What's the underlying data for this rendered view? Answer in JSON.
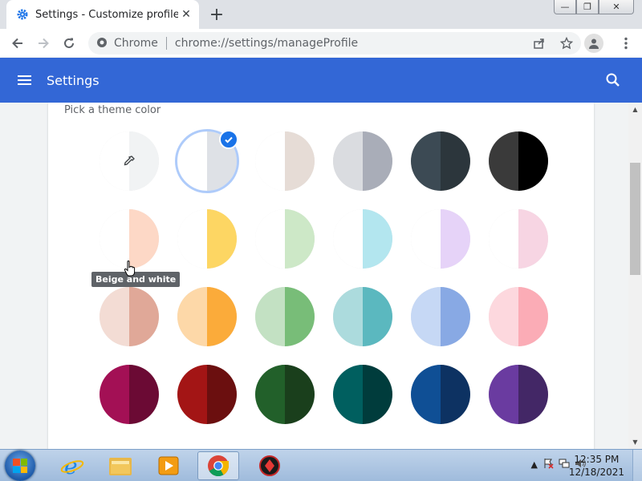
{
  "tab": {
    "title": "Settings - Customize profile",
    "close": "✕"
  },
  "newtab": "+",
  "window": {
    "min": "—",
    "max": "❐",
    "close": "✕"
  },
  "omnibox": {
    "chip": "Chrome",
    "url": "chrome://settings/manageProfile"
  },
  "header": {
    "title": "Settings"
  },
  "section": {
    "title": "Pick a theme color"
  },
  "tooltip": "Beige and white",
  "swatches": [
    {
      "name": "custom-color",
      "l": "#ffffff",
      "r": "#f1f3f4"
    },
    {
      "name": "default",
      "l": "#ffffff",
      "r": "#dee1e6",
      "selected": true
    },
    {
      "name": "light-beige",
      "l": "#ffffff",
      "r": "#e6dcd6"
    },
    {
      "name": "light-grey",
      "l": "#dadce0",
      "r": "#a9adb8"
    },
    {
      "name": "dark-slate",
      "l": "#3c4a54",
      "r": "#2c363c"
    },
    {
      "name": "black",
      "l": "#3a3a3a",
      "r": "#000000"
    },
    {
      "name": "beige-and-white",
      "l": "#ffffff",
      "r": "#fdd8c6"
    },
    {
      "name": "yellow-and-white",
      "l": "#ffffff",
      "r": "#fdd663"
    },
    {
      "name": "green-and-white",
      "l": "#ffffff",
      "r": "#cde8c7"
    },
    {
      "name": "light-teal-and-white",
      "l": "#ffffff",
      "r": "#b3e6ef"
    },
    {
      "name": "light-purple-and-white",
      "l": "#ffffff",
      "r": "#e6d3f8"
    },
    {
      "name": "pink-and-white",
      "l": "#ffffff",
      "r": "#f7d5e3"
    },
    {
      "name": "beige",
      "l": "#f3dcd4",
      "r": "#e0a898"
    },
    {
      "name": "orange",
      "l": "#fdd8a8",
      "r": "#fbab3a"
    },
    {
      "name": "light-green",
      "l": "#c3e1c3",
      "r": "#78bd78"
    },
    {
      "name": "light-teal",
      "l": "#acdbdd",
      "r": "#5bb8bf"
    },
    {
      "name": "light-blue",
      "l": "#c6d8f5",
      "r": "#88a9e4"
    },
    {
      "name": "light-pink",
      "l": "#fdd8de",
      "r": "#fbacb6"
    },
    {
      "name": "dark-pink",
      "l": "#a31055",
      "r": "#6b0a34"
    },
    {
      "name": "dark-red",
      "l": "#a31515",
      "r": "#6b0f0f"
    },
    {
      "name": "dark-green",
      "l": "#22602a",
      "r": "#1a3f1c"
    },
    {
      "name": "dark-teal",
      "l": "#005f5f",
      "r": "#003c3c"
    },
    {
      "name": "dark-blue",
      "l": "#0f4f95",
      "r": "#0d3262"
    },
    {
      "name": "purple",
      "l": "#6a3ba0",
      "r": "#432766"
    }
  ],
  "taskbar": {
    "time": "12:35 PM",
    "date": "12/18/2021"
  },
  "colors": {
    "header": "#3367d6",
    "accent": "#1a73e8"
  }
}
